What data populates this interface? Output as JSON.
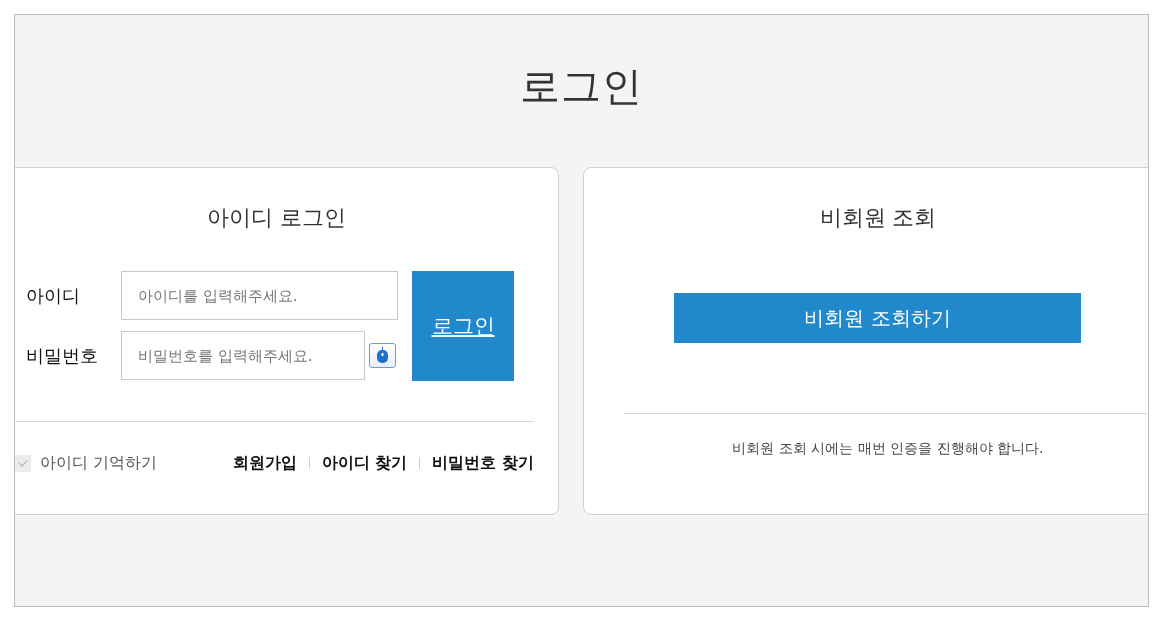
{
  "page_title": "로그인",
  "member_login": {
    "title": "아이디 로그인",
    "fields": [
      {
        "kind": "text",
        "label": "아이디",
        "placeholder": "아이디를 입력해주세요."
      },
      {
        "kind": "password",
        "label": "비밀번호",
        "placeholder": "비밀번호를 입력해주세요."
      }
    ],
    "login_button": "로그인",
    "remember_id": {
      "label": "아이디 기억하기",
      "checked": true
    },
    "links": [
      "회원가입",
      "아이디 찾기",
      "비밀번호 찾기"
    ]
  },
  "guest_lookup": {
    "title": "비회원 조회",
    "button": "비회원 조회하기",
    "notice": "비회원 조회 시에는 매번 인증을 진행해야 합니다."
  }
}
